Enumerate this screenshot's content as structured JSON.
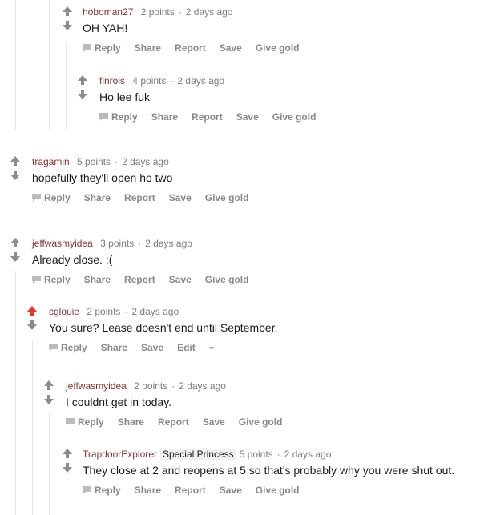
{
  "comments": [
    {
      "author": "hoboman27",
      "score": "2 points",
      "time": "2 days ago",
      "body": "OH YAH!",
      "flair": "",
      "upvoted": false,
      "actions": [
        "Reply",
        "Share",
        "Report",
        "Save",
        "Give gold"
      ]
    },
    {
      "author": "finrois",
      "score": "4 points",
      "time": "2 days ago",
      "body": "Ho lee fuk",
      "flair": "",
      "upvoted": false,
      "actions": [
        "Reply",
        "Share",
        "Report",
        "Save",
        "Give gold"
      ]
    },
    {
      "author": "tragamin",
      "score": "5 points",
      "time": "2 days ago",
      "body": "hopefully they'll open ho two",
      "flair": "",
      "upvoted": false,
      "actions": [
        "Reply",
        "Share",
        "Report",
        "Save",
        "Give gold"
      ]
    },
    {
      "author": "jeffwasmyidea",
      "score": "3 points",
      "time": "2 days ago",
      "body": "Already close. :(",
      "flair": "",
      "upvoted": false,
      "actions": [
        "Reply",
        "Share",
        "Report",
        "Save",
        "Give gold"
      ]
    },
    {
      "author": "cglouie",
      "score": "2 points",
      "time": "2 days ago",
      "body": "You sure? Lease doesn't end until September.",
      "flair": "",
      "upvoted": true,
      "actions": [
        "Reply",
        "Share",
        "Save",
        "Edit",
        "•••"
      ]
    },
    {
      "author": "jeffwasmyidea",
      "score": "2 points",
      "time": "2 days ago",
      "body": "I couldnt get in today.",
      "flair": "",
      "upvoted": false,
      "actions": [
        "Reply",
        "Share",
        "Report",
        "Save",
        "Give gold"
      ]
    },
    {
      "author": "TrapdoorExplorer",
      "score": "5 points",
      "time": "2 days ago",
      "body": "They close at 2 and reopens at 5 so that's probably why you were shut out.",
      "flair": "Special Princess",
      "upvoted": false,
      "actions": [
        "Reply",
        "Share",
        "Report",
        "Save",
        "Give gold"
      ]
    }
  ],
  "colors": {
    "upvote_active": "#ff4500",
    "arrow": "#8c8c8c",
    "author": "#8b2f2f"
  }
}
